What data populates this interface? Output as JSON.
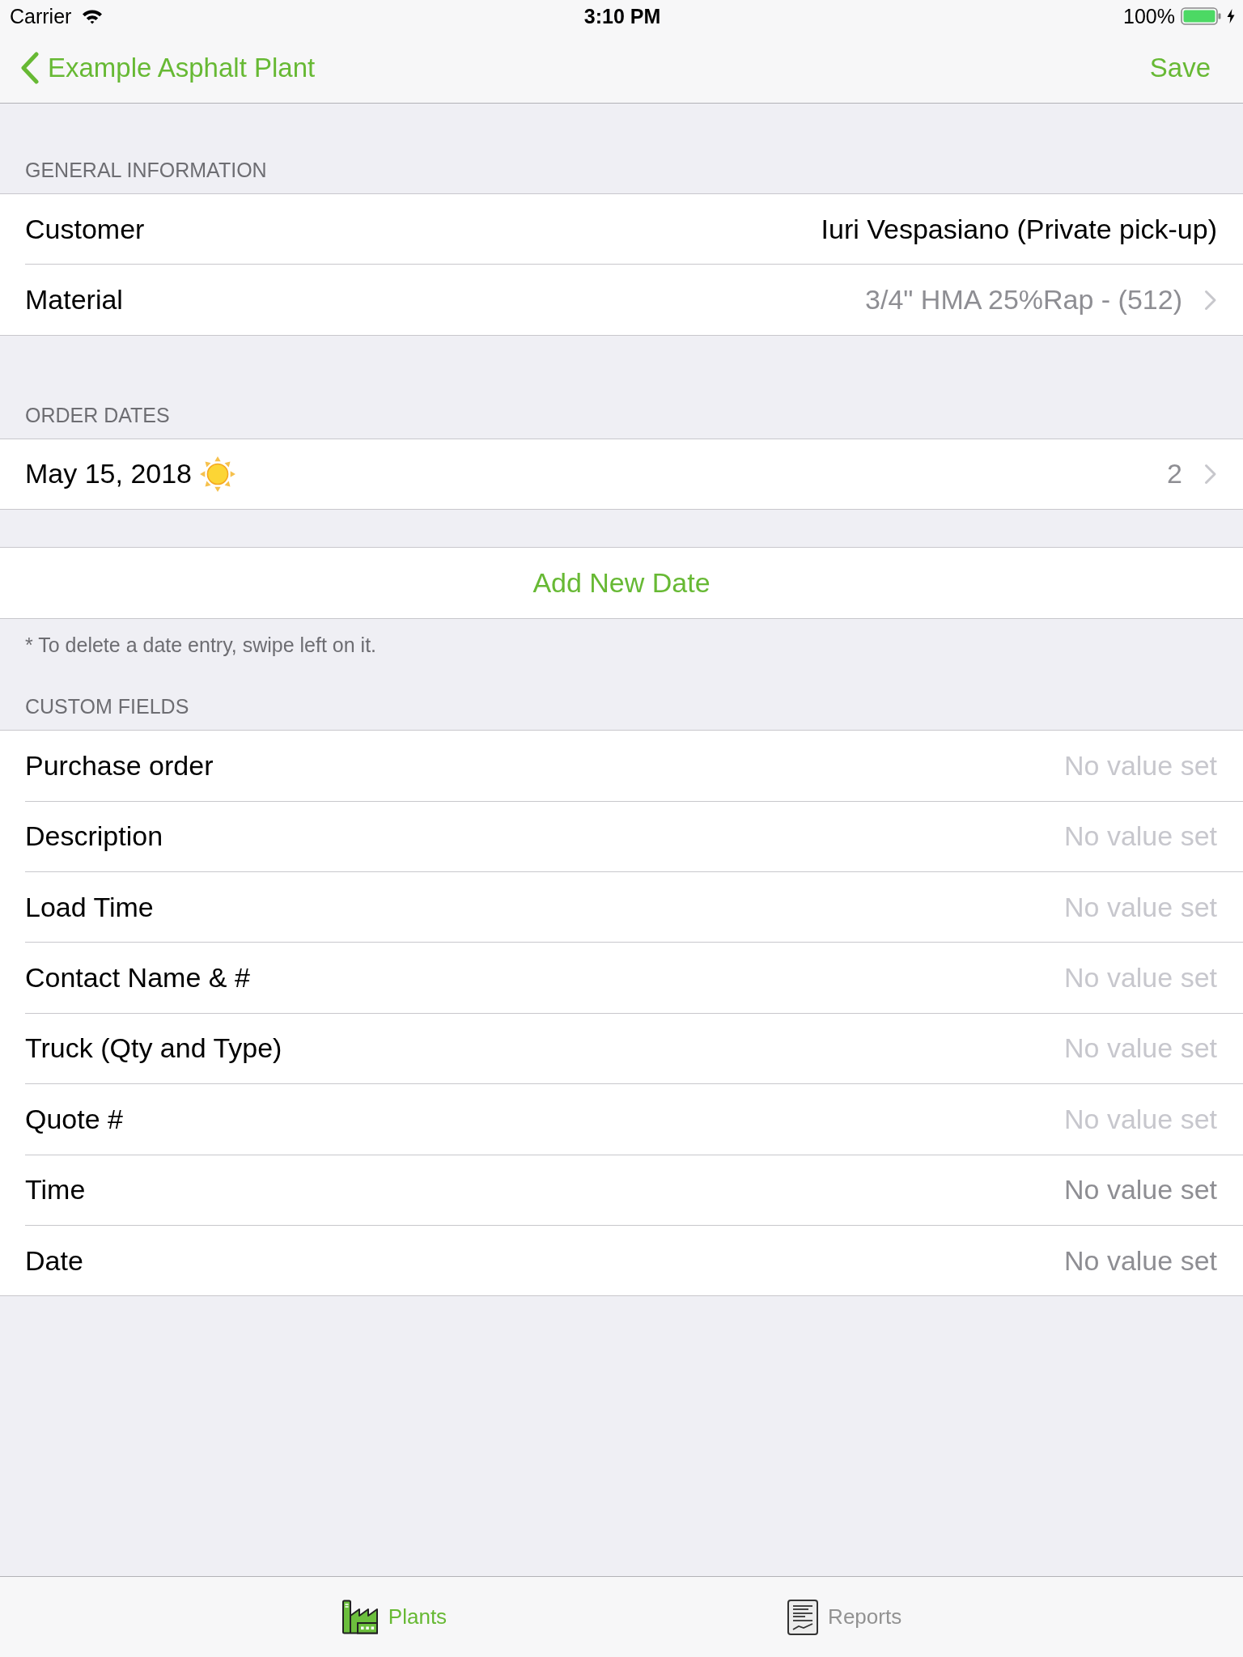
{
  "status_bar": {
    "carrier": "Carrier",
    "time": "3:10 PM",
    "battery": "100%"
  },
  "nav_bar": {
    "back": "Example Asphalt Plant",
    "action": "Save"
  },
  "sections": [
    {
      "header": "GENERAL INFORMATION",
      "rows": [
        {
          "kind": "info",
          "label": "Customer",
          "value": "Iuri Vespasiano (Private pick-up)",
          "disclosure": false
        },
        {
          "kind": "select",
          "label": "Material",
          "value": "3/4\" HMA 25%Rap - (512)",
          "disclosure": true
        }
      ]
    },
    {
      "header": "ORDER DATES",
      "rows": [
        {
          "kind": "date",
          "label": "May 15, 2018",
          "value": "2",
          "disclosure": true
        }
      ]
    },
    {
      "rows": [
        {
          "kind": "action",
          "label": "Add New Date"
        }
      ],
      "footer": "* To delete a date entry, swipe left on it."
    },
    {
      "header": "CUSTOM FIELDS",
      "rows": [
        {
          "kind": "text",
          "label": "Purchase order",
          "placeholder": "No value set"
        },
        {
          "kind": "text",
          "label": "Description",
          "placeholder": "No value set"
        },
        {
          "kind": "text",
          "label": "Load Time",
          "placeholder": "No value set"
        },
        {
          "kind": "text",
          "label": "Contact Name & #",
          "placeholder": "No value set"
        },
        {
          "kind": "text",
          "label": "Truck (Qty and Type)",
          "placeholder": "No value set"
        },
        {
          "kind": "text",
          "label": "Quote #",
          "placeholder": "No value set"
        },
        {
          "kind": "picker",
          "label": "Time",
          "value": "No value set"
        },
        {
          "kind": "picker",
          "label": "Date",
          "value": "No value set"
        }
      ]
    }
  ],
  "tab_bar": [
    {
      "label": "Plants",
      "selected": true
    },
    {
      "label": "Reports",
      "selected": false
    }
  ]
}
